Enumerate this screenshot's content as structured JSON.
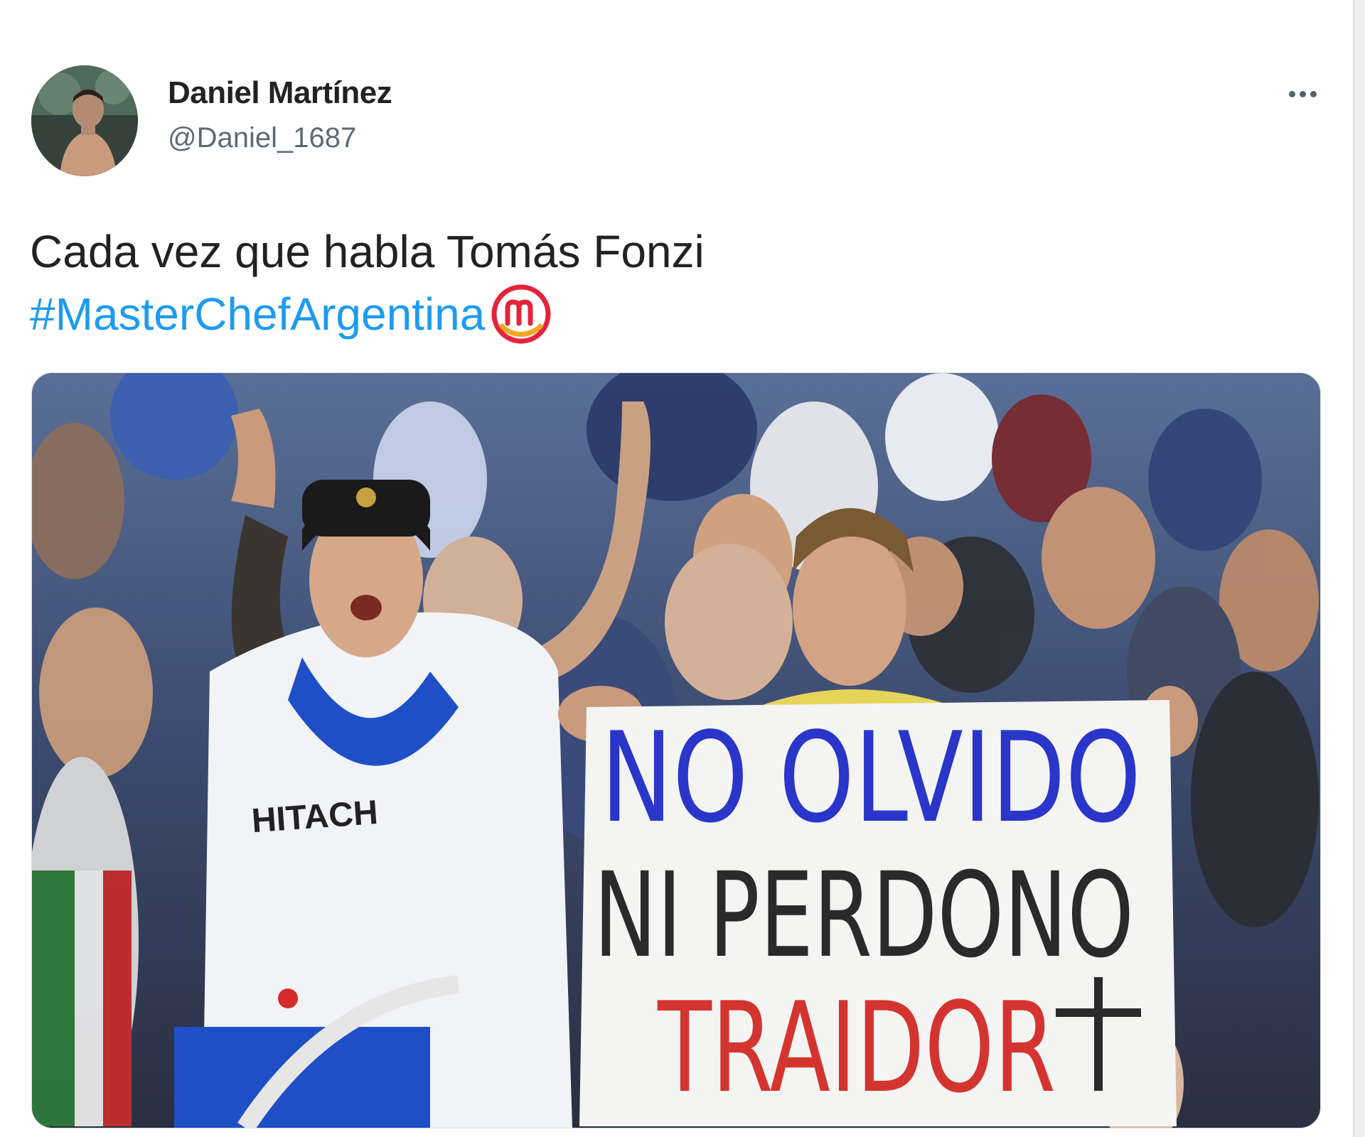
{
  "tweet": {
    "author": {
      "display_name": "Daniel Martínez",
      "handle": "@Daniel_1687",
      "avatar_icon": "user-avatar-photo"
    },
    "more_icon": "more-options-icon",
    "text_line1": "Cada vez que habla Tomás Fonzi",
    "hashtag": "#MasterChefArgentina",
    "hashtag_emoji": "masterchef-logo-icon",
    "hashtag_color": "#1d9bf0",
    "media": {
      "jersey_sponsor": "HITACH",
      "banner": {
        "line1": "NO OLVIDO",
        "line2": "NI PERDONO",
        "line3": "TRAIDOR",
        "line1_color": "#2a35c9",
        "line2_color": "#2a2a2a",
        "line3_color": "#d4342f"
      }
    }
  }
}
